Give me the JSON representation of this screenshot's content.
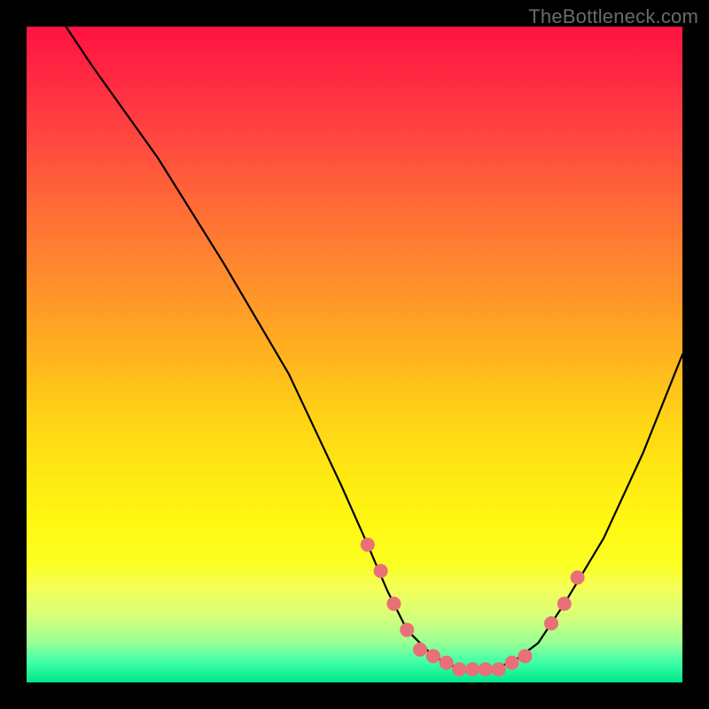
{
  "credit": "TheBottleneck.com",
  "chart_data": {
    "type": "line",
    "title": "",
    "xlabel": "",
    "ylabel": "",
    "xlim": [
      0,
      100
    ],
    "ylim": [
      0,
      100
    ],
    "series": [
      {
        "name": "bottleneck-curve",
        "x": [
          6,
          10,
          20,
          30,
          40,
          48,
          52,
          55,
          58,
          62,
          66,
          70,
          74,
          78,
          82,
          88,
          94,
          100
        ],
        "y": [
          100,
          94,
          80,
          64,
          47,
          30,
          21,
          14,
          8,
          4,
          2,
          2,
          3,
          6,
          12,
          22,
          35,
          50
        ]
      }
    ],
    "markers": {
      "name": "curve-dots",
      "x": [
        52,
        54,
        56,
        58,
        60,
        62,
        64,
        66,
        68,
        70,
        72,
        74,
        76,
        80,
        82,
        84
      ],
      "y": [
        21,
        17,
        12,
        8,
        5,
        4,
        3,
        2,
        2,
        2,
        2,
        3,
        4,
        9,
        12,
        16
      ],
      "color": "#e96f78",
      "radius": 8
    },
    "colors": {
      "curve": "#000000",
      "marker": "#e96f78"
    }
  }
}
